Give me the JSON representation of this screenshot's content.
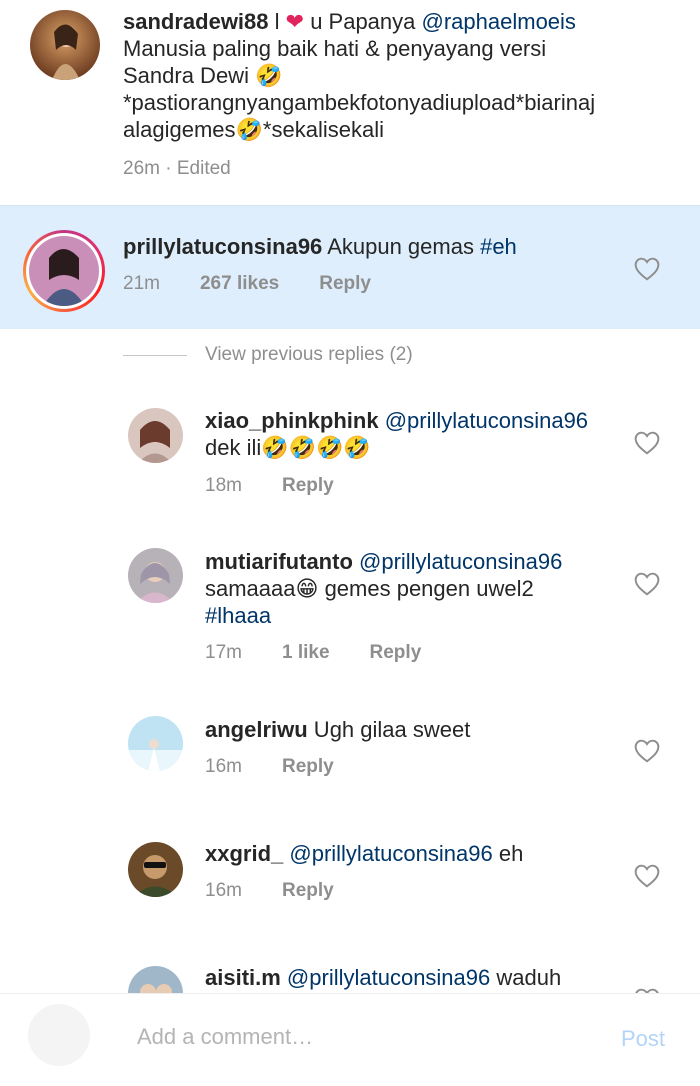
{
  "caption": {
    "username": "sandradewi88",
    "sep": " l ",
    "heart": "❤",
    "u": " u  Papanya ",
    "mention": "@raphaelmoeis",
    "line2": "Manusia paling baik hati & penyayang versi",
    "line3": "Sandra Dewi ",
    "line4": "*pastiorangnyangambekfotonyadiupload*biarinaj",
    "line5a": "alagigemes",
    "line5b": "*sekalisekali",
    "time": "26m",
    "edited": "Edited",
    "emoji": "🤣"
  },
  "main_comment": {
    "username": "prillylatuconsina96",
    "text": " Akupun gemas ",
    "hashtag": "#eh",
    "time": "21m",
    "likes": "267 likes",
    "reply": "Reply"
  },
  "view_previous": "View previous replies (2)",
  "replies": [
    {
      "username": "xiao_phinkphink",
      "mention": " @prillylatuconsina96",
      "line2": "dek ili",
      "emojis": "🤣🤣🤣🤣",
      "time": "18m",
      "reply": "Reply"
    },
    {
      "username": "mutiarifutanto",
      "mention": " @prillylatuconsina96",
      "line2a": "samaaaa",
      "emoji": "😁",
      "line2b": " gemes pengen uwel2",
      "hashtag": "#lhaaa",
      "time": "17m",
      "likes": "1 like",
      "reply": "Reply"
    },
    {
      "username": "angelriwu",
      "text": " Ugh gilaa sweet",
      "time": "16m",
      "reply": "Reply"
    },
    {
      "username": "xxgrid_",
      "mention": " @prillylatuconsina96",
      "text": " eh",
      "time": "16m",
      "reply": "Reply"
    },
    {
      "username": "aisiti.m",
      "mention": " @prillylatuconsina96",
      "text": " waduh"
    }
  ],
  "composer": {
    "placeholder": "Add a comment…",
    "post": "Post"
  },
  "colors": {
    "highlight": "#dfeefc",
    "mention": "#003569",
    "heart": "#ed4956",
    "post_disabled": "#b3d4f8"
  }
}
